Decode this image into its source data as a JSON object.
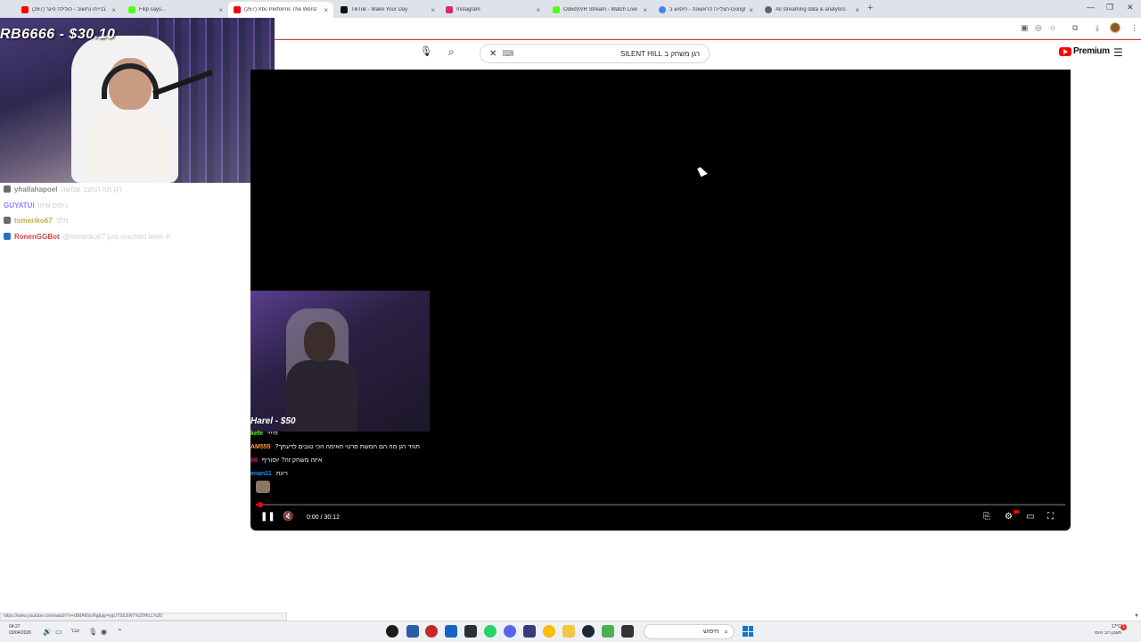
{
  "browser": {
    "tabs": [
      {
        "title": "בנייתו נחשוב - הולילה פיגר (267)",
        "favicon_color": "#ff0000",
        "active": false
      },
      {
        "title": "Filip says...",
        "favicon_color": "#53fc18",
        "active": false
      },
      {
        "title": "(267) Xbc Performs The Worst",
        "favicon_color": "#ff0000",
        "active": true
      },
      {
        "title": "TikTok - Make Your Day",
        "favicon_color": "#111111",
        "active": false
      },
      {
        "title": "Instagram",
        "favicon_color": "#d62976",
        "active": false
      },
      {
        "title": "OdedSVR Stream - Watch Live",
        "favicon_color": "#53fc18",
        "active": false
      },
      {
        "title": "הצלייה הראשונה - חיפוש ב-Google",
        "favicon_color": "#4285f4",
        "active": false
      },
      {
        "title": "All streaming data & analytics",
        "favicon_color": "#5f6368",
        "active": false
      }
    ],
    "tab_close_glyph": "×",
    "new_tab_glyph": "+",
    "window_controls": [
      "—",
      "❐",
      "✕"
    ],
    "status_url": "https://www.youtube.com/watch?v=x8kfAf6xcRg&pp=ygUTSILENT%20HILL%20"
  },
  "youtube": {
    "search_query": "רגן משחק ב SILENT HILL",
    "clear_glyph": "✕",
    "keyboard_glyph": "⌨",
    "search_glyph": "⌕",
    "mic_glyph": "🎙",
    "menu_glyph": "☰",
    "logo_text": "Premium",
    "logo_superscript": "IL",
    "player": {
      "current_time": "0:00",
      "duration": "30:12",
      "time_display": "0:00 / 30:12",
      "progress_fraction": 0.005,
      "pause_glyph": "❚❚",
      "mute_glyph": "🔇",
      "cc_glyph": "⎘",
      "settings_glyph": "⚙",
      "miniplayer_glyph": "▭",
      "fullscreen_glyph": "⛶"
    },
    "inner_overlay": {
      "donation": "Harel - $50",
      "chat": [
        {
          "user": "kefe",
          "message": "היייי",
          "color": "#53fc18"
        },
        {
          "user": "AM555",
          "message": "?תגיד רגן מה הם חמשת סרטי האימה הכי טובים לדעתך",
          "color": "#ff9a3c"
        },
        {
          "user": "68",
          "message": "איזה משחק זה? יוסוריף",
          "color": "#c71585"
        },
        {
          "user": "enan11",
          "message": "ריגת",
          "color": "#1e90ff"
        }
      ]
    }
  },
  "stream_overlay": {
    "donation": "RB6666 - $30.10"
  },
  "chat": [
    {
      "user": "yhallahapoel",
      "message": "רגן מה המצב שמשה",
      "user_color": "#8a8a8a"
    },
    {
      "user": "GUYATUI",
      "message": "ניפוס איזון",
      "user_color": "#9b7bff"
    },
    {
      "user": "tomeriko67",
      "message": "מלך",
      "user_color": "#d2a64b"
    },
    {
      "user": "RonenGGBot",
      "message": "@tomeriko67 just reached level 4!",
      "user_color": "#e0413b"
    }
  ],
  "taskbar": {
    "clock_time": "04:27",
    "clock_date": "03/04/2026",
    "language": "עבר",
    "search_placeholder": "חיפוש",
    "weather_temp": "17°C",
    "weather_desc": "מעונן רוב היום",
    "notification_count": "1"
  }
}
